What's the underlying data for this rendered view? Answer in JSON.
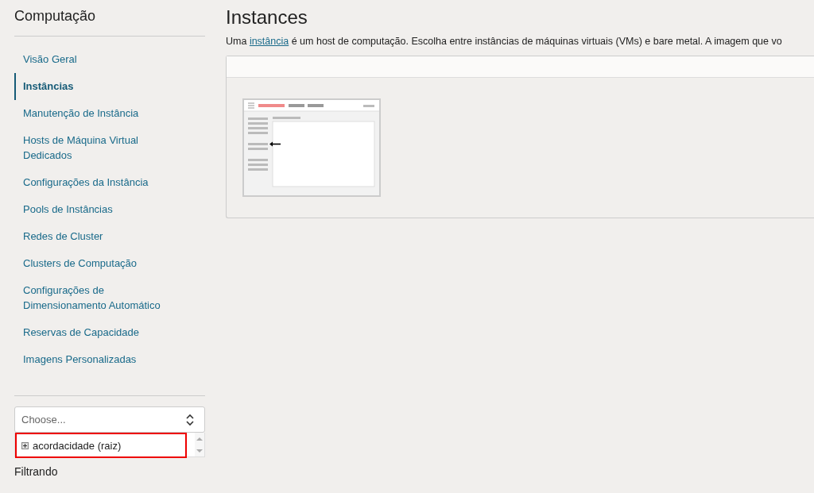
{
  "sidebar": {
    "title": "Computação",
    "items": [
      {
        "label": "Visão Geral",
        "selected": false
      },
      {
        "label": "Instâncias",
        "selected": true
      },
      {
        "label": "Manutenção de Instância",
        "selected": false
      },
      {
        "label": "Hosts de Máquina Virtual Dedicados",
        "selected": false
      },
      {
        "label": "Configurações da Instância",
        "selected": false
      },
      {
        "label": "Pools de Instâncias",
        "selected": false
      },
      {
        "label": "Redes de Cluster",
        "selected": false
      },
      {
        "label": "Clusters de Computação",
        "selected": false
      },
      {
        "label": "Configurações de Dimensionamento Automático",
        "selected": false
      },
      {
        "label": "Reservas de Capacidade",
        "selected": false
      },
      {
        "label": "Imagens Personalizadas",
        "selected": false
      }
    ],
    "compartment_select": {
      "placeholder": "Choose...",
      "options": [
        {
          "label": "acordacidade (raiz)",
          "highlighted": true
        }
      ]
    },
    "filter_heading": "Filtrando"
  },
  "main": {
    "title": "Instances",
    "description_before": "Uma",
    "description_link": "instância",
    "description_after": "é um host de computação. Escolha entre instâncias de máquinas virtuais (VMs) e bare metal. A imagem que vo"
  }
}
